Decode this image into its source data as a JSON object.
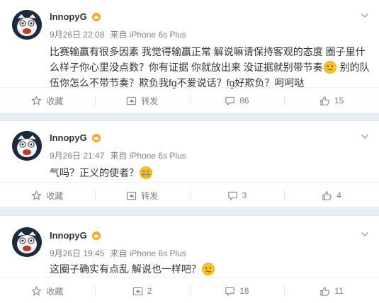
{
  "posts": [
    {
      "username": "InnopyG",
      "badge_icon": "vip-crown-icon",
      "time": "9月26日 22:08",
      "source": "来自 iPhone 6s Plus",
      "text_a": "比赛输赢有很多因素 我觉得输赢正常 解说嘛请保持客观的态度 圈子里什么样子你心里没点数？你有证据 你就放出来 没证据就别带节奏",
      "emoji_1": "awkward-smile-emoji",
      "text_b": " 别的队伍你怎么不带节奏？欺负我fg不爱说话？fg好欺负？呵呵哒",
      "actions": {
        "favorite": "收藏",
        "repost": "转发",
        "comments": "86",
        "likes": "15"
      }
    },
    {
      "username": "InnopyG",
      "badge_icon": "vip-crown-icon",
      "time": "9月26日 21:47",
      "source": "来自 iPhone 6s Plus",
      "text_a": "气吗？正义的使者？",
      "emoji_1": "grin-emoji",
      "actions": {
        "favorite": "收藏",
        "repost": "转发",
        "comments": "3",
        "likes": "4"
      }
    },
    {
      "username": "InnopyG",
      "badge_icon": "vip-crown-icon",
      "time": "9月26日 19:45",
      "source": "来自 iPhone 6s Plus",
      "text_a": "这圈子确实有点乱 解说也一样吧？",
      "emoji_1": "confused-emoji",
      "actions": {
        "favorite": "收藏",
        "repost": "2",
        "comments": "18",
        "likes": "11"
      }
    }
  ],
  "colors": {
    "accent_badge": "#f5a623",
    "text": "#333333",
    "meta": "#808080",
    "emoji": "#f7c325"
  }
}
